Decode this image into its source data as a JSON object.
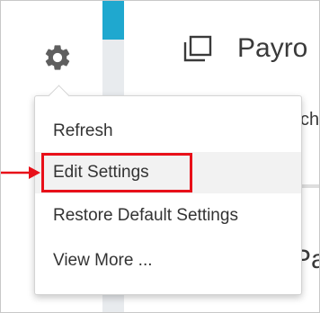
{
  "app": {
    "title": "Payro"
  },
  "main": {
    "fragment_1": "ch",
    "fragment_2": "Pa"
  },
  "menu": {
    "items": [
      {
        "label": "Refresh"
      },
      {
        "label": "Edit Settings"
      },
      {
        "label": "Restore Default Settings"
      },
      {
        "label": "View More ..."
      }
    ]
  },
  "icons": {
    "settings": "gear-icon",
    "window": "window-stack-icon",
    "pointer": "arrow-right-icon"
  },
  "colors": {
    "accent": "#1fa8cf",
    "highlight": "#e81019",
    "text": "#333333"
  }
}
